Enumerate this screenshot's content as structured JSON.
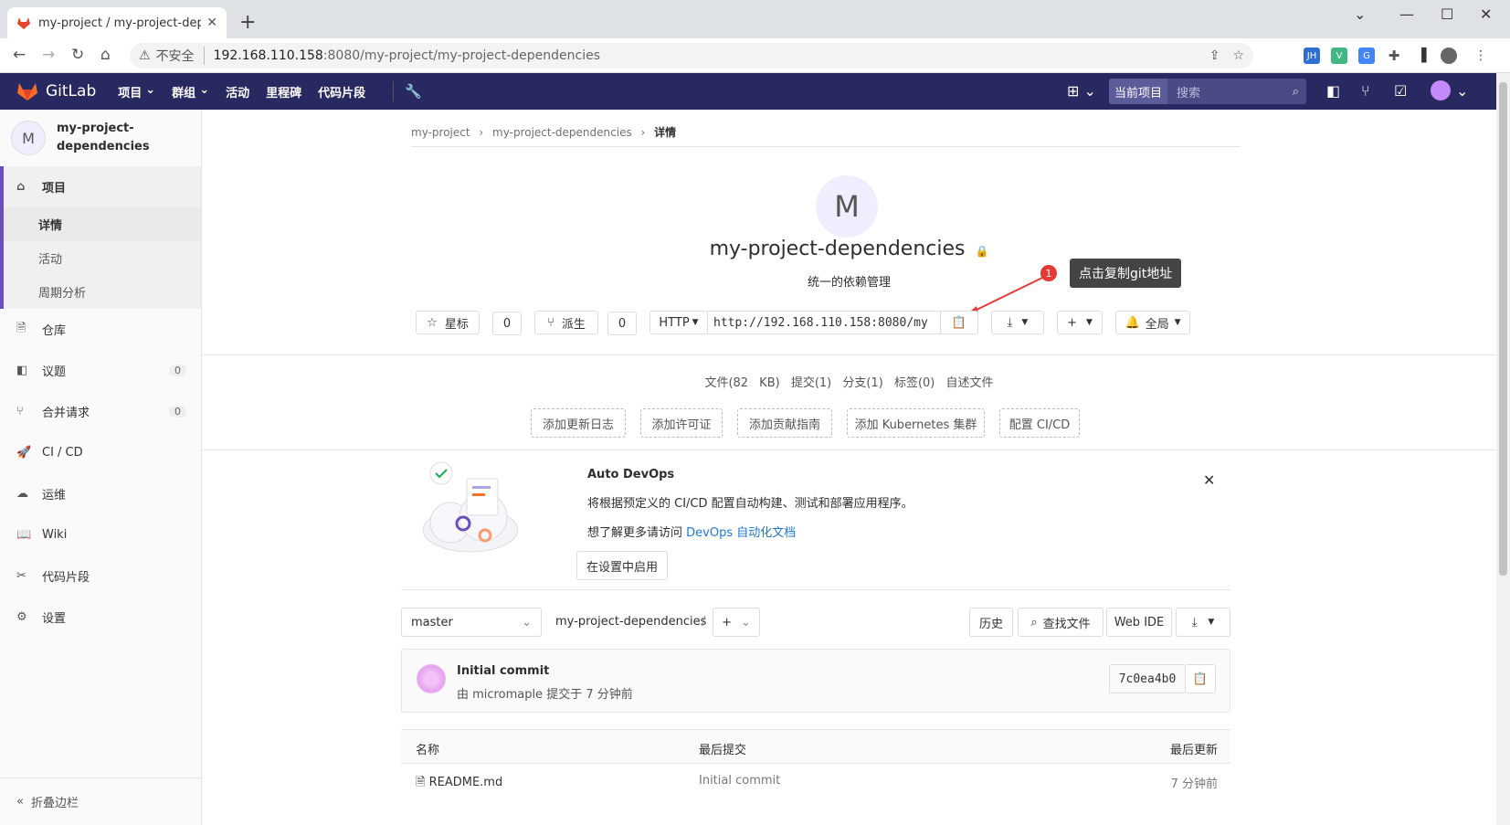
{
  "browser": {
    "tab_title": "my-project / my-project-depe",
    "insecure_label": "不安全",
    "url_host": "192.168.110.158",
    "url_rest": ":8080/my-project/my-project-dependencies",
    "ext_jh": "JH"
  },
  "header": {
    "brand": "GitLab",
    "nav": [
      "项目",
      "群组",
      "活动",
      "里程碑",
      "代码片段"
    ],
    "search_scope": "当前项目",
    "search_placeholder": "搜索"
  },
  "sidebar": {
    "project_initial": "M",
    "project_name_line1": "my-project-",
    "project_name_line2": "dependencies",
    "section_label": "项目",
    "sub_items": [
      "详情",
      "活动",
      "周期分析"
    ],
    "items": [
      {
        "label": "仓库"
      },
      {
        "label": "议题",
        "count": "0"
      },
      {
        "label": "合并请求",
        "count": "0"
      },
      {
        "label": "CI / CD"
      },
      {
        "label": "运维"
      },
      {
        "label": "Wiki"
      },
      {
        "label": "代码片段"
      },
      {
        "label": "设置"
      }
    ],
    "collapse_label": "折叠边栏"
  },
  "breadcrumb": {
    "root": "my-project",
    "project": "my-project-dependencies",
    "current": "详情"
  },
  "project": {
    "initial": "M",
    "title": "my-project-dependencies",
    "description": "统一的依赖管理"
  },
  "annotation": {
    "marker": "1",
    "tooltip": "点击复制git地址"
  },
  "actions": {
    "star_label": "星标",
    "star_count": "0",
    "fork_label": "派生",
    "fork_count": "0",
    "protocol": "HTTP",
    "clone_url": "http://192.168.110.158:8080/my",
    "notify_label": "全局"
  },
  "stats": {
    "files": "文件(82 KB)",
    "commits": "提交(1)",
    "branches": "分支(1)",
    "tags": "标签(0)",
    "readme": "自述文件"
  },
  "quick_adds": [
    "添加更新日志",
    "添加许可证",
    "添加贡献指南",
    "添加 Kubernetes 集群",
    "配置 CI/CD"
  ],
  "devops": {
    "title": "Auto DevOps",
    "description": "将根据预定义的 CI/CD 配置自动构建、测试和部署应用程序。",
    "more_prefix": "想了解更多请访问 ",
    "more_link": "DevOps 自动化文档",
    "enable_button": "在设置中启用"
  },
  "repo": {
    "branch": "master",
    "path": "my-project-dependencies",
    "path_sep": "/",
    "history_button": "历史",
    "find_file_button": "查找文件",
    "web_ide_button": "Web IDE"
  },
  "commit": {
    "title": "Initial commit",
    "meta": "由 micromaple 提交于 7 分钟前",
    "sha": "7c0ea4b0"
  },
  "table": {
    "headers": [
      "名称",
      "最后提交",
      "最后更新"
    ],
    "rows": [
      {
        "name": "README.md",
        "commit": "Initial commit",
        "updated": "7 分钟前"
      }
    ]
  },
  "colors": {
    "header_bg": "#292961",
    "accent": "#6b4fbb",
    "link": "#1f78d1",
    "marker": "#e53935"
  }
}
